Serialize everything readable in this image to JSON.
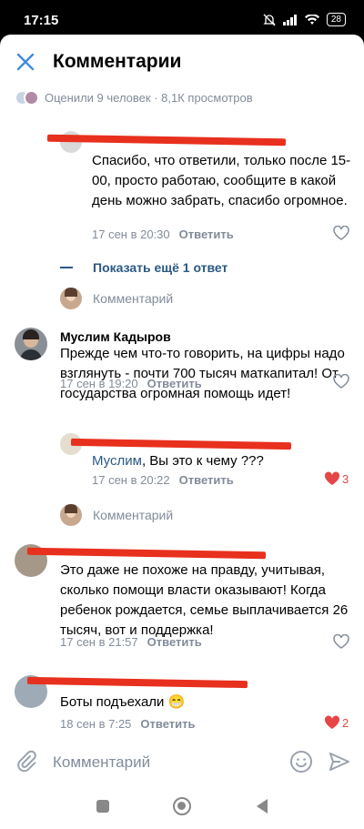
{
  "status": {
    "time": "17:15",
    "battery": "28"
  },
  "header": {
    "title": "Комментарии",
    "likes_text": "Оценили 9 человек · 8,1К просмотров"
  },
  "comments": [
    {
      "text": "Спасибо, что ответили, только после 15-00, просто работаю, сообщите в какой день можно забрать, спасибо огромное.",
      "date": "17 сен в 20:30",
      "reply_label": "Ответить"
    },
    {
      "author": "Муслим Кадыров",
      "text": "Прежде чем что-то говорить, на цифры надо взглянуть - почти 700 тысяч маткапитал! От государства огромная помощь идет!",
      "date": "17 сен в 19:20",
      "reply_label": "Ответить"
    },
    {
      "mention": "Муслим",
      "text": ", Вы это к чему ???",
      "date": "17 сен в 20:22",
      "reply_label": "Ответить",
      "likes": "3"
    },
    {
      "text": "Это даже не похоже на правду, учитывая, сколько помощи власти оказывают! Когда ребенок рождается, семье выплачивается 26 тысяч, вот и поддержка!",
      "date": "17 сен в 21:57",
      "reply_label": "Ответить"
    },
    {
      "text": "Боты подъехали 😁",
      "date": "18 сен в 7:25",
      "reply_label": "Ответить",
      "likes": "2"
    }
  ],
  "show_more": "Показать ещё 1 ответ",
  "compose_placeholder": "Комментарий",
  "input_placeholder": "Комментарий",
  "colors": {
    "link": "#2a5885",
    "secondary": "#818c99",
    "like": "#e64646",
    "redaction": "#e8301e"
  }
}
